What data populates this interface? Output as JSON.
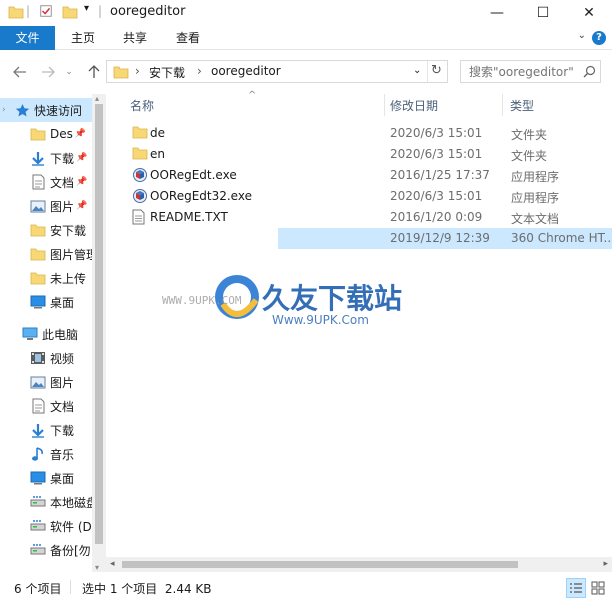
{
  "window": {
    "title": "ooregeditor",
    "controls": {
      "minimize": "—",
      "maximize": "☐",
      "close": "✕"
    }
  },
  "ribbon": {
    "tabs": [
      "文件",
      "主页",
      "共享",
      "查看"
    ],
    "help": "?"
  },
  "address": {
    "path": [
      "安下载",
      "ooregeditor"
    ],
    "search_placeholder": "搜索\"ooregeditor\""
  },
  "nav": {
    "quick_access_label": "快速访问",
    "quick_items": [
      {
        "label": "Des",
        "icon": "folder-icon",
        "pinned": true
      },
      {
        "label": "下载",
        "icon": "download-icon",
        "pinned": true
      },
      {
        "label": "文档",
        "icon": "document-icon",
        "pinned": true
      },
      {
        "label": "图片",
        "icon": "picture-icon",
        "pinned": true
      },
      {
        "label": "安下载",
        "icon": "folder-icon",
        "pinned": false
      },
      {
        "label": "图片管理",
        "icon": "folder-icon",
        "pinned": false
      },
      {
        "label": "未上传",
        "icon": "folder-icon",
        "pinned": false
      },
      {
        "label": "桌面",
        "icon": "desktop-icon",
        "pinned": false
      }
    ],
    "this_pc_label": "此电脑",
    "pc_items": [
      {
        "label": "视频",
        "icon": "video-icon"
      },
      {
        "label": "图片",
        "icon": "picture-icon"
      },
      {
        "label": "文档",
        "icon": "document-icon"
      },
      {
        "label": "下载",
        "icon": "download-icon"
      },
      {
        "label": "音乐",
        "icon": "music-icon"
      },
      {
        "label": "桌面",
        "icon": "desktop-icon"
      },
      {
        "label": "本地磁盘",
        "icon": "drive-icon"
      },
      {
        "label": "软件 (D",
        "icon": "drive-icon"
      },
      {
        "label": "备份[勿",
        "icon": "drive-icon"
      }
    ]
  },
  "columns": {
    "name": "名称",
    "date": "修改日期",
    "type": "类型"
  },
  "files": [
    {
      "name": "de",
      "date": "2020/6/3 15:01",
      "type": "文件夹",
      "icon": "folder-icon",
      "selected": false
    },
    {
      "name": "en",
      "date": "2020/6/3 15:01",
      "type": "文件夹",
      "icon": "folder-icon",
      "selected": false
    },
    {
      "name": "OORegEdt.exe",
      "date": "2016/1/25 17:37",
      "type": "应用程序",
      "icon": "app-icon",
      "selected": false
    },
    {
      "name": "OORegEdt32.exe",
      "date": "2020/6/3 15:01",
      "type": "应用程序",
      "icon": "app-icon",
      "selected": false
    },
    {
      "name": "README.TXT",
      "date": "2016/1/20 0:09",
      "type": "文本文档",
      "icon": "text-file-icon",
      "selected": false
    },
    {
      "name": "",
      "date": "2019/12/9 12:39",
      "type": "360 Chrome HT...",
      "icon": "",
      "selected": true
    }
  ],
  "watermark": {
    "brand": "久友下载站",
    "url_left": "WWW.9UPK.COM",
    "url_right": "Www.9UPK.Com"
  },
  "status": {
    "count": "6 个项目",
    "selection": "选中 1 个项目  2.44 KB"
  },
  "colors": {
    "accent": "#1979ca",
    "selection": "#cce8ff",
    "folder": "#f8d775"
  }
}
